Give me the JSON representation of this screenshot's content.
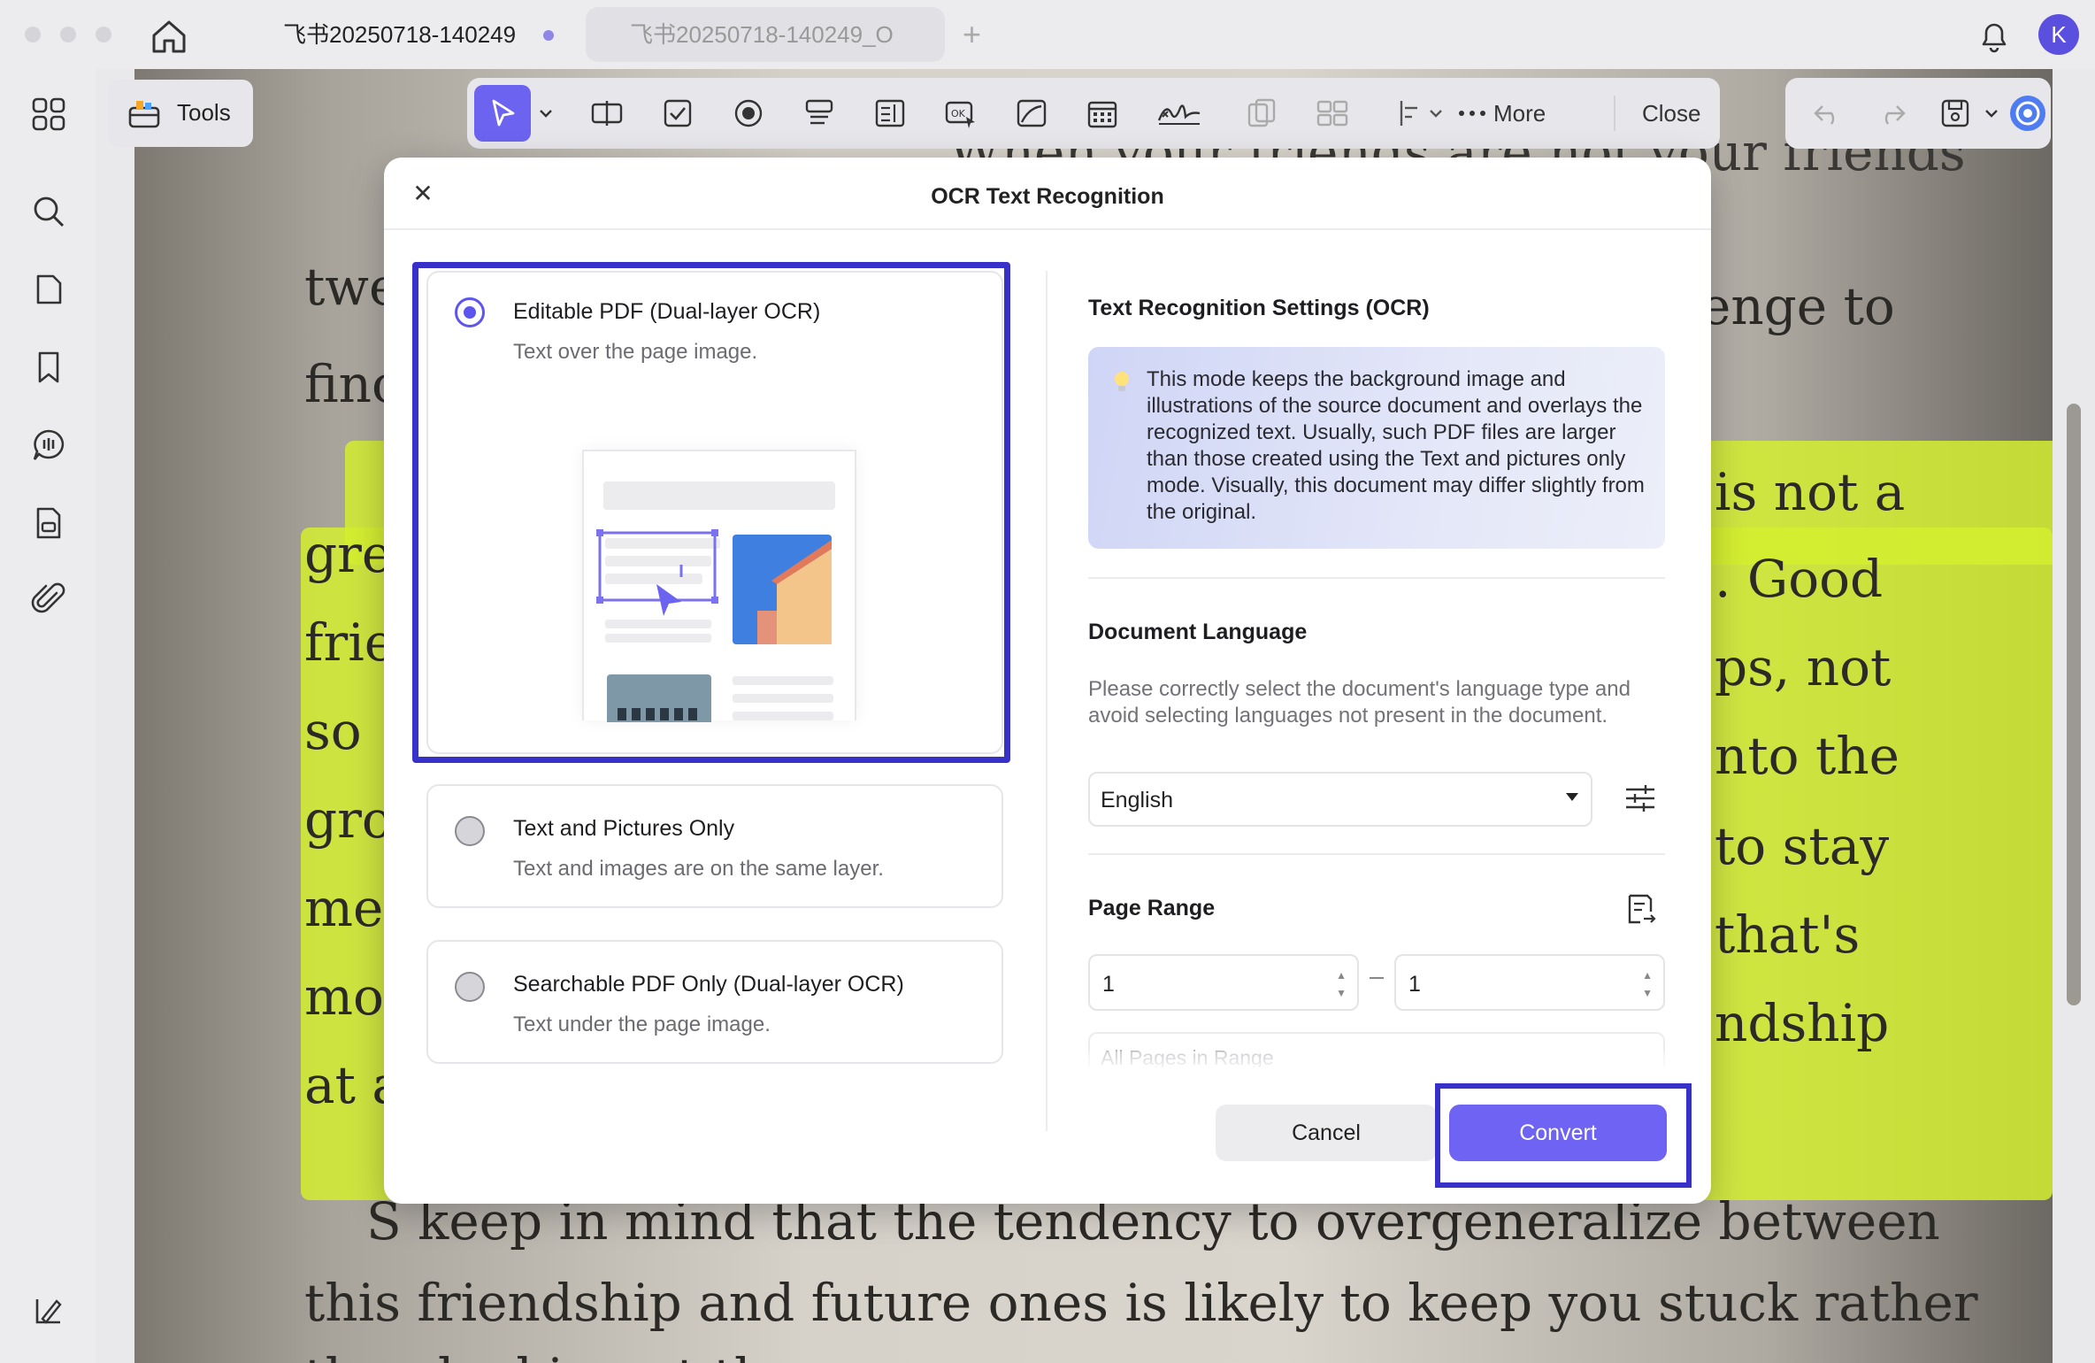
{
  "tabs": [
    {
      "label": "飞书20250718-140249",
      "active": true
    },
    {
      "label": "飞书20250718-140249_O"
    }
  ],
  "user": {
    "initial": "K"
  },
  "toolbar": {
    "tools_label": "Tools",
    "more_label": "More",
    "close_label": "Close"
  },
  "document": {
    "lines": [
      "When your friends are not your friends",
      "twe",
      "enge to",
      "finc",
      "is not a",
      "gre",
      ". Good",
      "frie",
      "ps, not",
      "so",
      "nto the",
      "gro",
      "to stay",
      "me",
      "that's",
      "mo",
      "ndship",
      "at a",
      "S keep in mind that the tendency to overgeneralize between",
      "this friendship and future ones is likely to keep you stuck rather",
      "than looking at the"
    ]
  },
  "modal": {
    "title": "OCR Text Recognition",
    "options": [
      {
        "name": "Editable PDF (Dual-layer OCR)",
        "desc": "Text over the page image.",
        "selected": true
      },
      {
        "name": "Text and Pictures Only",
        "desc": "Text and images are on the same layer.",
        "selected": false
      },
      {
        "name": "Searchable PDF Only (Dual-layer OCR)",
        "desc": "Text under the page image.",
        "selected": false
      }
    ],
    "settings_title": "Text Recognition Settings (OCR)",
    "info_text": "This mode keeps the background image and illustrations of the source document and overlays the recognized text. Usually, such PDF files are larger than those created using the Text and pictures only mode. Visually, this document may differ slightly from the original.",
    "language_title": "Document Language",
    "language_hint": "Please correctly select the document's language type and avoid selecting languages not present in the document.",
    "language_value": "English",
    "page_range_title": "Page Range",
    "range_from": "1",
    "range_separator": "–",
    "range_to": "1",
    "range_mode": "All Pages in Range",
    "cancel_label": "Cancel",
    "convert_label": "Convert"
  },
  "colors": {
    "accent": "#6e63f2",
    "focus": "#3730c9",
    "highlight": "#d3ee2f"
  }
}
